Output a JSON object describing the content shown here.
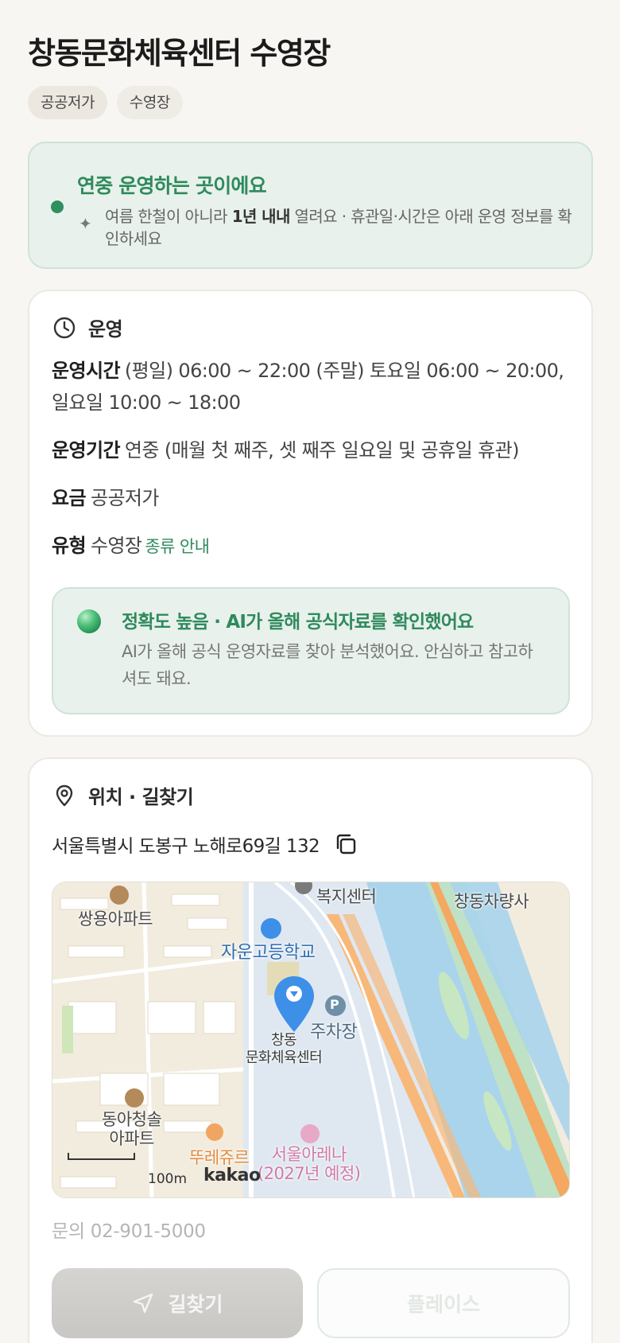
{
  "header": {
    "title": "창동문화체육센터 수영장",
    "tags": [
      "공공저가",
      "수영장"
    ]
  },
  "notice": {
    "title": "연중 운영하는 곳이에요",
    "text_pre": "여름 한철이 아니라 ",
    "text_bold": "1년 내내",
    "text_post": " 열려요 · 휴관일·시간은 아래 운영 정보를 확인하세요"
  },
  "operation": {
    "section_label": "운영",
    "hours_key": "운영시간",
    "hours_value": "(평일) 06:00 ~ 22:00 (주말) 토요일 06:00 ~ 20:00, 일요일 10:00 ~ 18:00",
    "period_key": "운영기간",
    "period_value": "연중 (매월 첫 째주, 셋 째주 일요일 및 공휴일 휴관)",
    "fee_key": "요금",
    "fee_value": "공공저가",
    "type_key": "유형",
    "type_value": "수영장",
    "type_link": "종류 안내",
    "accuracy_title": "정확도 높음 · AI가 올해 공식자료를 확인했어요",
    "accuracy_text": "AI가 올해 공식 운영자료를 찾아 분석했어요. 안심하고 참고하셔도 돼요."
  },
  "location": {
    "section_label": "위치 · 길찾기",
    "address": "서울특별시 도봉구 노해로69길 132",
    "map": {
      "labels": {
        "apt1": "쌍용아파트",
        "welfare": "복지센터",
        "depot": "창동차량사",
        "school": "자운고등학교",
        "parking": "주차장",
        "parking_p": "P",
        "place_line1": "창동",
        "place_line2": "문화체육센터",
        "apt2_line1": "동아청솔",
        "apt2_line2": "아파트",
        "arena_line1": "서울아레나",
        "arena_line2": "(2027년 예정)",
        "food": "뚜레쥬르"
      },
      "scale": "100m",
      "brand": "kakao"
    },
    "phone": "문의 02-901-5000",
    "directions_button": "길찾기",
    "place_button": "플레이스"
  },
  "colors": {
    "accent_green": "#2f8a5c",
    "map_pin": "#3d8fe8"
  }
}
